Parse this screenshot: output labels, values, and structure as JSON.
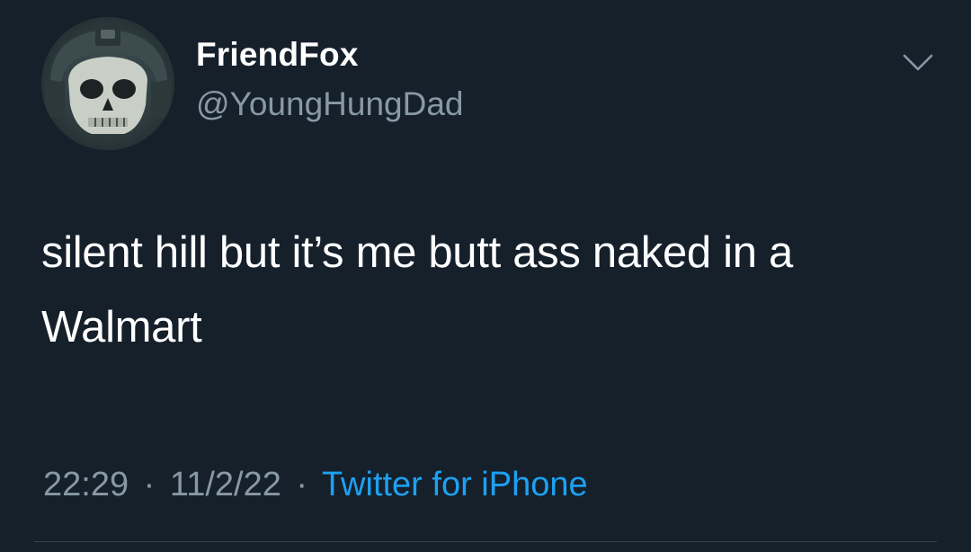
{
  "tweet": {
    "display_name": "FriendFox",
    "handle": "@YoungHungDad",
    "text": "silent hill but it’s me butt ass naked in a Walmart",
    "time": "22:29",
    "date": "11/2/22",
    "separator": "·",
    "source": "Twitter for iPhone",
    "menu_icon": "chevron-down-icon",
    "avatar_icon": "skull-helmet-avatar"
  },
  "colors": {
    "background": "#15202b",
    "primary_text": "#ffffff",
    "secondary_text": "#8899a6",
    "accent": "#1da1f2",
    "divider": "#38444d"
  }
}
